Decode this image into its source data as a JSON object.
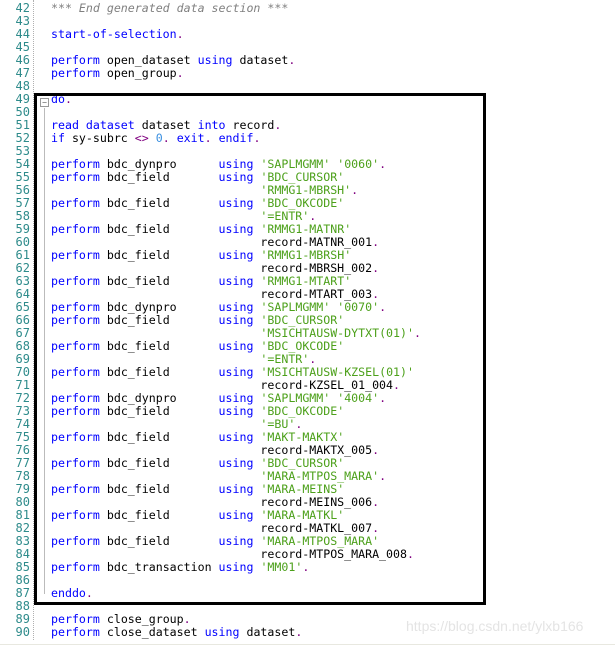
{
  "colors": {
    "keyword": "#0000ff",
    "string": "#4ca01a",
    "punct": "#800080",
    "number": "#3a8fe0",
    "comment": "#808080",
    "line_number": "#2e8b8b"
  },
  "fold_icon": "collapse-icon",
  "watermark": "https://blog.csdn.net/ylxb166",
  "lines": [
    {
      "n": "42",
      "tokens": [
        [
          "cmt",
          "*** End generated data section ***"
        ]
      ]
    },
    {
      "n": "43",
      "tokens": []
    },
    {
      "n": "44",
      "tokens": [
        [
          "kw",
          "start-of-selection"
        ],
        [
          "pun",
          "."
        ]
      ]
    },
    {
      "n": "45",
      "tokens": []
    },
    {
      "n": "46",
      "tokens": [
        [
          "kw",
          "perform"
        ],
        [
          "plain",
          " open_dataset "
        ],
        [
          "kw",
          "using"
        ],
        [
          "plain",
          " dataset"
        ],
        [
          "pun",
          "."
        ]
      ]
    },
    {
      "n": "47",
      "tokens": [
        [
          "kw",
          "perform"
        ],
        [
          "plain",
          " open_group"
        ],
        [
          "pun",
          "."
        ]
      ]
    },
    {
      "n": "48",
      "tokens": []
    },
    {
      "n": "49",
      "tokens": [
        [
          "kw",
          "do"
        ],
        [
          "pun",
          "."
        ]
      ]
    },
    {
      "n": "50",
      "tokens": []
    },
    {
      "n": "51",
      "tokens": [
        [
          "kw",
          "read dataset"
        ],
        [
          "plain",
          " dataset "
        ],
        [
          "kw",
          "into"
        ],
        [
          "plain",
          " record"
        ],
        [
          "pun",
          "."
        ]
      ]
    },
    {
      "n": "52",
      "tokens": [
        [
          "kw",
          "if"
        ],
        [
          "plain",
          " sy-subrc "
        ],
        [
          "pun",
          "<>"
        ],
        [
          "plain",
          " "
        ],
        [
          "num",
          "0"
        ],
        [
          "pun",
          "."
        ],
        [
          "plain",
          " "
        ],
        [
          "kw",
          "exit"
        ],
        [
          "pun",
          "."
        ],
        [
          "plain",
          " "
        ],
        [
          "kw",
          "endif"
        ],
        [
          "pun",
          "."
        ]
      ]
    },
    {
      "n": "53",
      "tokens": []
    },
    {
      "n": "54",
      "tokens": [
        [
          "kw",
          "perform"
        ],
        [
          "plain",
          " bdc_dynpro      "
        ],
        [
          "kw",
          "using"
        ],
        [
          "plain",
          " "
        ],
        [
          "str",
          "'SAPLMGMM' '0060'"
        ],
        [
          "pun",
          "."
        ]
      ]
    },
    {
      "n": "55",
      "tokens": [
        [
          "kw",
          "perform"
        ],
        [
          "plain",
          " bdc_field       "
        ],
        [
          "kw",
          "using"
        ],
        [
          "plain",
          " "
        ],
        [
          "str",
          "'BDC_CURSOR'"
        ]
      ]
    },
    {
      "n": "56",
      "tokens": [
        [
          "plain",
          "                              "
        ],
        [
          "str",
          "'RMMG1-MBRSH'"
        ],
        [
          "pun",
          "."
        ]
      ]
    },
    {
      "n": "57",
      "tokens": [
        [
          "kw",
          "perform"
        ],
        [
          "plain",
          " bdc_field       "
        ],
        [
          "kw",
          "using"
        ],
        [
          "plain",
          " "
        ],
        [
          "str",
          "'BDC_OKCODE'"
        ]
      ]
    },
    {
      "n": "58",
      "tokens": [
        [
          "plain",
          "                              "
        ],
        [
          "str",
          "'=ENTR'"
        ],
        [
          "pun",
          "."
        ]
      ]
    },
    {
      "n": "59",
      "tokens": [
        [
          "kw",
          "perform"
        ],
        [
          "plain",
          " bdc_field       "
        ],
        [
          "kw",
          "using"
        ],
        [
          "plain",
          " "
        ],
        [
          "str",
          "'RMMG1-MATNR'"
        ]
      ]
    },
    {
      "n": "60",
      "tokens": [
        [
          "plain",
          "                              record-MATNR_001"
        ],
        [
          "pun",
          "."
        ]
      ]
    },
    {
      "n": "61",
      "tokens": [
        [
          "kw",
          "perform"
        ],
        [
          "plain",
          " bdc_field       "
        ],
        [
          "kw",
          "using"
        ],
        [
          "plain",
          " "
        ],
        [
          "str",
          "'RMMG1-MBRSH'"
        ]
      ]
    },
    {
      "n": "62",
      "tokens": [
        [
          "plain",
          "                              record-MBRSH_002"
        ],
        [
          "pun",
          "."
        ]
      ]
    },
    {
      "n": "63",
      "tokens": [
        [
          "kw",
          "perform"
        ],
        [
          "plain",
          " bdc_field       "
        ],
        [
          "kw",
          "using"
        ],
        [
          "plain",
          " "
        ],
        [
          "str",
          "'RMMG1-MTART'"
        ]
      ]
    },
    {
      "n": "64",
      "tokens": [
        [
          "plain",
          "                              record-MTART_003"
        ],
        [
          "pun",
          "."
        ]
      ]
    },
    {
      "n": "65",
      "tokens": [
        [
          "kw",
          "perform"
        ],
        [
          "plain",
          " bdc_dynpro      "
        ],
        [
          "kw",
          "using"
        ],
        [
          "plain",
          " "
        ],
        [
          "str",
          "'SAPLMGMM' '0070'"
        ],
        [
          "pun",
          "."
        ]
      ]
    },
    {
      "n": "66",
      "tokens": [
        [
          "kw",
          "perform"
        ],
        [
          "plain",
          " bdc_field       "
        ],
        [
          "kw",
          "using"
        ],
        [
          "plain",
          " "
        ],
        [
          "str",
          "'BDC_CURSOR'"
        ]
      ]
    },
    {
      "n": "67",
      "tokens": [
        [
          "plain",
          "                              "
        ],
        [
          "str",
          "'MSICHTAUSW-DYTXT(01)'"
        ],
        [
          "pun",
          "."
        ]
      ]
    },
    {
      "n": "68",
      "tokens": [
        [
          "kw",
          "perform"
        ],
        [
          "plain",
          " bdc_field       "
        ],
        [
          "kw",
          "using"
        ],
        [
          "plain",
          " "
        ],
        [
          "str",
          "'BDC_OKCODE'"
        ]
      ]
    },
    {
      "n": "69",
      "tokens": [
        [
          "plain",
          "                              "
        ],
        [
          "str",
          "'=ENTR'"
        ],
        [
          "pun",
          "."
        ]
      ]
    },
    {
      "n": "70",
      "tokens": [
        [
          "kw",
          "perform"
        ],
        [
          "plain",
          " bdc_field       "
        ],
        [
          "kw",
          "using"
        ],
        [
          "plain",
          " "
        ],
        [
          "str",
          "'MSICHTAUSW-KZSEL(01)'"
        ]
      ]
    },
    {
      "n": "71",
      "tokens": [
        [
          "plain",
          "                              record-KZSEL_01_004"
        ],
        [
          "pun",
          "."
        ]
      ]
    },
    {
      "n": "72",
      "tokens": [
        [
          "kw",
          "perform"
        ],
        [
          "plain",
          " bdc_dynpro      "
        ],
        [
          "kw",
          "using"
        ],
        [
          "plain",
          " "
        ],
        [
          "str",
          "'SAPLMGMM' '4004'"
        ],
        [
          "pun",
          "."
        ]
      ]
    },
    {
      "n": "73",
      "tokens": [
        [
          "kw",
          "perform"
        ],
        [
          "plain",
          " bdc_field       "
        ],
        [
          "kw",
          "using"
        ],
        [
          "plain",
          " "
        ],
        [
          "str",
          "'BDC_OKCODE'"
        ]
      ]
    },
    {
      "n": "74",
      "tokens": [
        [
          "plain",
          "                              "
        ],
        [
          "str",
          "'=BU'"
        ],
        [
          "pun",
          "."
        ]
      ]
    },
    {
      "n": "75",
      "tokens": [
        [
          "kw",
          "perform"
        ],
        [
          "plain",
          " bdc_field       "
        ],
        [
          "kw",
          "using"
        ],
        [
          "plain",
          " "
        ],
        [
          "str",
          "'MAKT-MAKTX'"
        ]
      ]
    },
    {
      "n": "76",
      "tokens": [
        [
          "plain",
          "                              record-MAKTX_005"
        ],
        [
          "pun",
          "."
        ]
      ]
    },
    {
      "n": "77",
      "tokens": [
        [
          "kw",
          "perform"
        ],
        [
          "plain",
          " bdc_field       "
        ],
        [
          "kw",
          "using"
        ],
        [
          "plain",
          " "
        ],
        [
          "str",
          "'BDC_CURSOR'"
        ]
      ]
    },
    {
      "n": "78",
      "tokens": [
        [
          "plain",
          "                              "
        ],
        [
          "str",
          "'MARA-MTPOS_MARA'"
        ],
        [
          "pun",
          "."
        ]
      ]
    },
    {
      "n": "79",
      "tokens": [
        [
          "kw",
          "perform"
        ],
        [
          "plain",
          " bdc_field       "
        ],
        [
          "kw",
          "using"
        ],
        [
          "plain",
          " "
        ],
        [
          "str",
          "'MARA-MEINS'"
        ]
      ]
    },
    {
      "n": "80",
      "tokens": [
        [
          "plain",
          "                              record-MEINS_006"
        ],
        [
          "pun",
          "."
        ]
      ]
    },
    {
      "n": "81",
      "tokens": [
        [
          "kw",
          "perform"
        ],
        [
          "plain",
          " bdc_field       "
        ],
        [
          "kw",
          "using"
        ],
        [
          "plain",
          " "
        ],
        [
          "str",
          "'MARA-MATKL'"
        ]
      ]
    },
    {
      "n": "82",
      "tokens": [
        [
          "plain",
          "                              record-MATKL_007"
        ],
        [
          "pun",
          "."
        ]
      ]
    },
    {
      "n": "83",
      "tokens": [
        [
          "kw",
          "perform"
        ],
        [
          "plain",
          " bdc_field       "
        ],
        [
          "kw",
          "using"
        ],
        [
          "plain",
          " "
        ],
        [
          "str",
          "'MARA-MTPOS_MARA'"
        ]
      ]
    },
    {
      "n": "84",
      "tokens": [
        [
          "plain",
          "                              record-MTPOS_MARA_008"
        ],
        [
          "pun",
          "."
        ]
      ]
    },
    {
      "n": "85",
      "tokens": [
        [
          "kw",
          "perform"
        ],
        [
          "plain",
          " bdc_transaction "
        ],
        [
          "kw",
          "using"
        ],
        [
          "plain",
          " "
        ],
        [
          "str",
          "'MM01'"
        ],
        [
          "pun",
          "."
        ]
      ]
    },
    {
      "n": "86",
      "tokens": []
    },
    {
      "n": "87",
      "tokens": [
        [
          "kw",
          "enddo"
        ],
        [
          "pun",
          "."
        ]
      ]
    },
    {
      "n": "88",
      "tokens": []
    },
    {
      "n": "89",
      "tokens": [
        [
          "kw",
          "perform"
        ],
        [
          "plain",
          " close_group"
        ],
        [
          "pun",
          "."
        ]
      ]
    },
    {
      "n": "90",
      "tokens": [
        [
          "kw",
          "perform"
        ],
        [
          "plain",
          " close_dataset "
        ],
        [
          "kw",
          "using"
        ],
        [
          "plain",
          " dataset"
        ],
        [
          "pun",
          "."
        ]
      ]
    }
  ]
}
